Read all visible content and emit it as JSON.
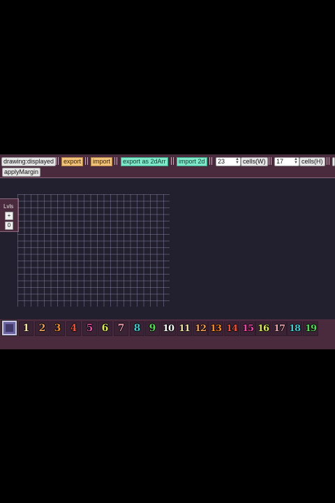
{
  "toolbar": {
    "drawing_mode": "drawing:displayed",
    "export_label": "export",
    "import_label": "import",
    "export_2d_label": "export as 2dArr",
    "import_2d_label": "import 2d",
    "width_value": "23",
    "width_unit": "cells(W)",
    "height_value": "17",
    "height_unit": "cells(H)",
    "apply_margin_label": "applyMargin"
  },
  "levels": {
    "title": "Lvls",
    "add_label": "+",
    "current": "0"
  },
  "palette": {
    "tiles": [
      {
        "label": "1",
        "color": "#f3e2a6"
      },
      {
        "label": "2",
        "color": "#e89a58"
      },
      {
        "label": "3",
        "color": "#f08a2a"
      },
      {
        "label": "4",
        "color": "#e8503a"
      },
      {
        "label": "5",
        "color": "#e84aa8"
      },
      {
        "label": "6",
        "color": "#d8e85a"
      },
      {
        "label": "7",
        "color": "#f0a0b0"
      },
      {
        "label": "8",
        "color": "#44c8d0"
      },
      {
        "label": "9",
        "color": "#58d858"
      },
      {
        "label": "10",
        "color": "#ffffff"
      },
      {
        "label": "11",
        "color": "#f3e2a6"
      },
      {
        "label": "12",
        "color": "#e89a58"
      },
      {
        "label": "13",
        "color": "#f08a2a"
      },
      {
        "label": "14",
        "color": "#e8503a"
      },
      {
        "label": "15",
        "color": "#e84aa8"
      },
      {
        "label": "16",
        "color": "#d8e85a"
      },
      {
        "label": "17",
        "color": "#f0a0b0"
      },
      {
        "label": "18",
        "color": "#44c8d0"
      },
      {
        "label": "19",
        "color": "#58d858"
      }
    ]
  }
}
